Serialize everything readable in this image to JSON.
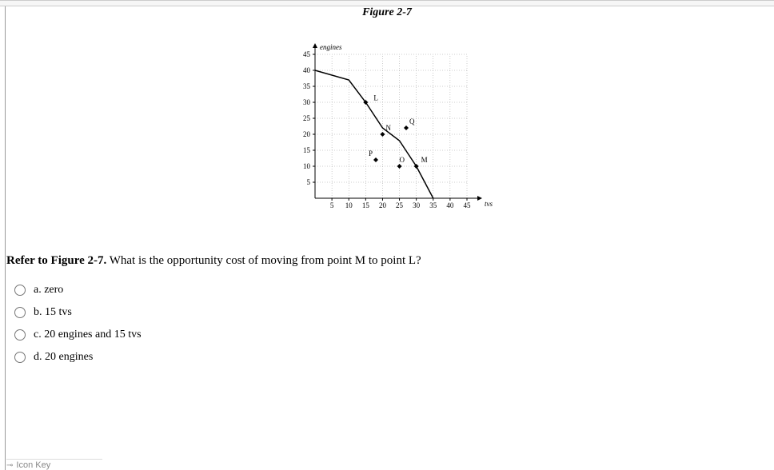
{
  "figure_title": "Figure 2-7",
  "question_prefix": "Refer to Figure 2-7.",
  "question_text": " What is the opportunity cost of moving from point M to point L?",
  "options": {
    "a": "a. zero",
    "b": "b. 15 tvs",
    "c": "c. 20 engines and 15 tvs",
    "d": "d. 20 engines"
  },
  "footer": "Icon Key",
  "chart_data": {
    "type": "line",
    "title": "",
    "xlabel": "tvs",
    "ylabel": "engines",
    "xlim": [
      0,
      45
    ],
    "ylim": [
      0,
      45
    ],
    "x_ticks": [
      5,
      10,
      15,
      20,
      25,
      30,
      35,
      40,
      45
    ],
    "y_ticks": [
      5,
      10,
      15,
      20,
      25,
      30,
      35,
      40,
      45
    ],
    "curve": [
      {
        "x": 0,
        "y": 40
      },
      {
        "x": 10,
        "y": 37
      },
      {
        "x": 15,
        "y": 30
      },
      {
        "x": 20,
        "y": 22
      },
      {
        "x": 25,
        "y": 18
      },
      {
        "x": 30,
        "y": 10
      },
      {
        "x": 35,
        "y": 0
      }
    ],
    "points": [
      {
        "name": "L",
        "x": 15,
        "y": 30,
        "label_dx": 5,
        "label_dy": 2
      },
      {
        "name": "N",
        "x": 20,
        "y": 20,
        "label_dx": 2,
        "label_dy": 4
      },
      {
        "name": "Q",
        "x": 27,
        "y": 22,
        "label_dx": 2,
        "label_dy": 4
      },
      {
        "name": "P",
        "x": 18,
        "y": 12,
        "label_dx": -2,
        "label_dy": 4
      },
      {
        "name": "O",
        "x": 25,
        "y": 10,
        "label_dx": 0,
        "label_dy": 4
      },
      {
        "name": "M",
        "x": 30,
        "y": 10,
        "label_dx": 3,
        "label_dy": 4
      }
    ]
  }
}
